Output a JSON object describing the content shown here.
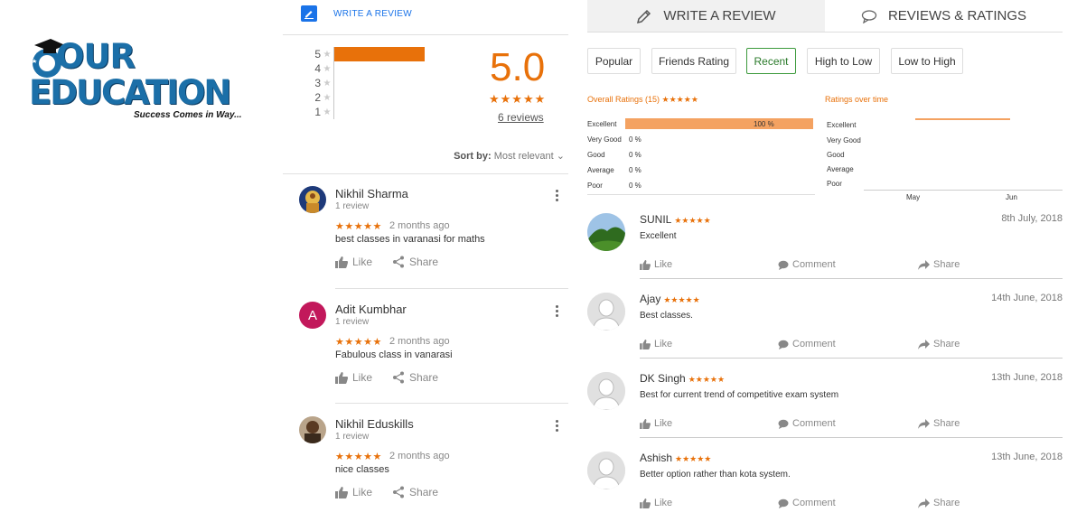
{
  "logo": {
    "line1": "OUR",
    "line2": "EDUCATION",
    "tagline": "Success Comes in Way..."
  },
  "google": {
    "write_label": "WRITE A REVIEW",
    "histogram": [
      {
        "stars": "5",
        "fraction": 1.0
      },
      {
        "stars": "4",
        "fraction": 0
      },
      {
        "stars": "3",
        "fraction": 0
      },
      {
        "stars": "2",
        "fraction": 0
      },
      {
        "stars": "1",
        "fraction": 0
      }
    ],
    "score": "5.0",
    "score_stars": "★★★★★",
    "reviews_link": "6 reviews",
    "sort_label": "Sort by:",
    "sort_value": "Most relevant",
    "like_label": "Like",
    "share_label": "Share",
    "reviews": [
      {
        "name": "Nikhil Sharma",
        "count": "1 review",
        "stars": "★★★★★",
        "when": "2 months ago",
        "text": "best classes in varanasi for maths",
        "avatar": "photo"
      },
      {
        "name": "Adit Kumbhar",
        "count": "1 review",
        "stars": "★★★★★",
        "when": "2 months ago",
        "text": "Fabulous class in vanarasi",
        "avatar": "A",
        "avatar_color": "#c2185b"
      },
      {
        "name": "Nikhil Eduskills",
        "count": "1 review",
        "stars": "★★★★★",
        "when": "2 months ago",
        "text": "nice classes",
        "avatar": "photo"
      }
    ]
  },
  "right": {
    "tabs": [
      {
        "label": "WRITE A REVIEW",
        "icon": "pencil-icon"
      },
      {
        "label": "REVIEWS & RATINGS",
        "icon": "speech-bubble-icon"
      }
    ],
    "filters": [
      "Popular",
      "Friends Rating",
      "Recent",
      "High to Low",
      "Low to High"
    ],
    "active_filter": "Recent",
    "overall_title": "Overall Ratings (15)",
    "overall_stars": "★★★★★",
    "overall": [
      {
        "label": "Excellent",
        "pct": "100 %",
        "value": 100
      },
      {
        "label": "Very Good",
        "pct": "0 %",
        "value": 0
      },
      {
        "label": "Good",
        "pct": "0 %",
        "value": 0
      },
      {
        "label": "Average",
        "pct": "0 %",
        "value": 0
      },
      {
        "label": "Poor",
        "pct": "0 %",
        "value": 0
      }
    ],
    "time_title": "Ratings over time",
    "time_labels": [
      "Excellent",
      "Very Good",
      "Good",
      "Average",
      "Poor"
    ],
    "time_x": [
      "May",
      "Jun"
    ],
    "like_label": "Like",
    "comment_label": "Comment",
    "share_label": "Share",
    "reviews": [
      {
        "name": "SUNIL",
        "stars": "★★★★★",
        "date": "8th July, 2018",
        "text": "Excellent",
        "avatar": "photo"
      },
      {
        "name": "Ajay",
        "stars": "★★★★★",
        "date": "14th June, 2018",
        "text": "Best classes.",
        "avatar": "default"
      },
      {
        "name": "DK Singh",
        "stars": "★★★★★",
        "date": "13th June, 2018",
        "text": "Best for current trend of competitive exam system",
        "avatar": "default"
      },
      {
        "name": "Ashish",
        "stars": "★★★★★",
        "date": "13th June, 2018",
        "text": "Better option rather than kota system.",
        "avatar": "default"
      }
    ]
  },
  "colors": {
    "accent": "#e8710a",
    "link": "#1a73e8",
    "brand": "#1b6fa8",
    "active_filter": "#3c9a3c"
  }
}
